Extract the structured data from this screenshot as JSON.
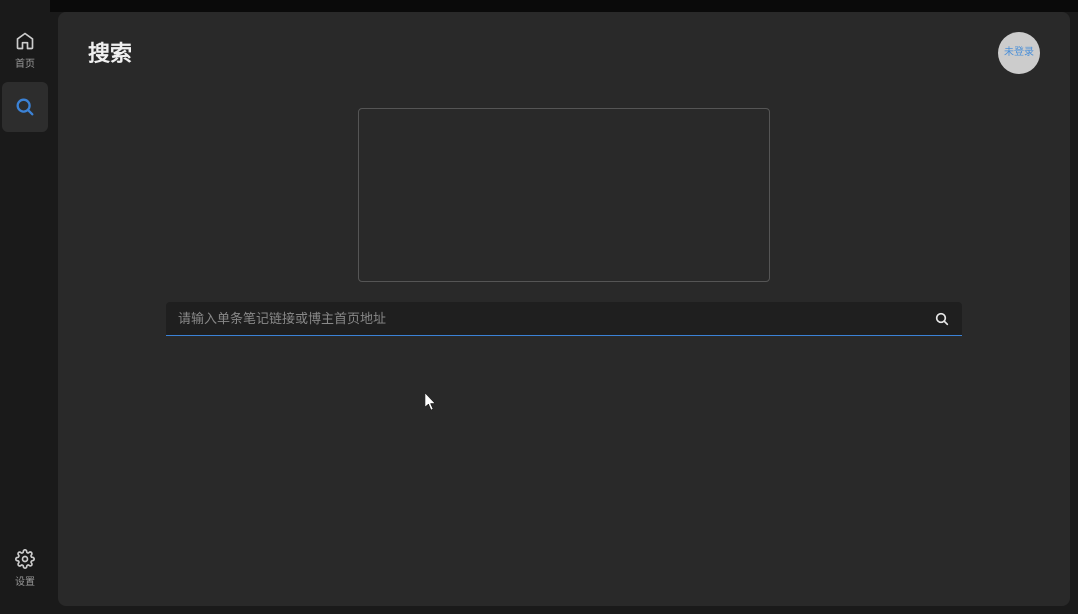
{
  "sidebar": {
    "home_label": "首页",
    "settings_label": "设置"
  },
  "page": {
    "title": "搜索"
  },
  "user": {
    "status": "未登录"
  },
  "search": {
    "placeholder": "请输入单条笔记链接或博主首页地址"
  }
}
